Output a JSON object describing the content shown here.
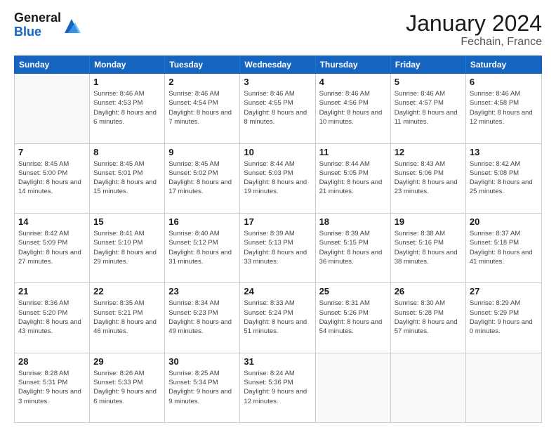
{
  "header": {
    "logo_general": "General",
    "logo_blue": "Blue",
    "title": "January 2024",
    "subtitle": "Fechain, France"
  },
  "days_of_week": [
    "Sunday",
    "Monday",
    "Tuesday",
    "Wednesday",
    "Thursday",
    "Friday",
    "Saturday"
  ],
  "weeks": [
    [
      {
        "day": "",
        "sunrise": "",
        "sunset": "",
        "daylight": ""
      },
      {
        "day": "1",
        "sunrise": "Sunrise: 8:46 AM",
        "sunset": "Sunset: 4:53 PM",
        "daylight": "Daylight: 8 hours and 6 minutes."
      },
      {
        "day": "2",
        "sunrise": "Sunrise: 8:46 AM",
        "sunset": "Sunset: 4:54 PM",
        "daylight": "Daylight: 8 hours and 7 minutes."
      },
      {
        "day": "3",
        "sunrise": "Sunrise: 8:46 AM",
        "sunset": "Sunset: 4:55 PM",
        "daylight": "Daylight: 8 hours and 8 minutes."
      },
      {
        "day": "4",
        "sunrise": "Sunrise: 8:46 AM",
        "sunset": "Sunset: 4:56 PM",
        "daylight": "Daylight: 8 hours and 10 minutes."
      },
      {
        "day": "5",
        "sunrise": "Sunrise: 8:46 AM",
        "sunset": "Sunset: 4:57 PM",
        "daylight": "Daylight: 8 hours and 11 minutes."
      },
      {
        "day": "6",
        "sunrise": "Sunrise: 8:46 AM",
        "sunset": "Sunset: 4:58 PM",
        "daylight": "Daylight: 8 hours and 12 minutes."
      }
    ],
    [
      {
        "day": "7",
        "sunrise": "Sunrise: 8:45 AM",
        "sunset": "Sunset: 5:00 PM",
        "daylight": "Daylight: 8 hours and 14 minutes."
      },
      {
        "day": "8",
        "sunrise": "Sunrise: 8:45 AM",
        "sunset": "Sunset: 5:01 PM",
        "daylight": "Daylight: 8 hours and 15 minutes."
      },
      {
        "day": "9",
        "sunrise": "Sunrise: 8:45 AM",
        "sunset": "Sunset: 5:02 PM",
        "daylight": "Daylight: 8 hours and 17 minutes."
      },
      {
        "day": "10",
        "sunrise": "Sunrise: 8:44 AM",
        "sunset": "Sunset: 5:03 PM",
        "daylight": "Daylight: 8 hours and 19 minutes."
      },
      {
        "day": "11",
        "sunrise": "Sunrise: 8:44 AM",
        "sunset": "Sunset: 5:05 PM",
        "daylight": "Daylight: 8 hours and 21 minutes."
      },
      {
        "day": "12",
        "sunrise": "Sunrise: 8:43 AM",
        "sunset": "Sunset: 5:06 PM",
        "daylight": "Daylight: 8 hours and 23 minutes."
      },
      {
        "day": "13",
        "sunrise": "Sunrise: 8:42 AM",
        "sunset": "Sunset: 5:08 PM",
        "daylight": "Daylight: 8 hours and 25 minutes."
      }
    ],
    [
      {
        "day": "14",
        "sunrise": "Sunrise: 8:42 AM",
        "sunset": "Sunset: 5:09 PM",
        "daylight": "Daylight: 8 hours and 27 minutes."
      },
      {
        "day": "15",
        "sunrise": "Sunrise: 8:41 AM",
        "sunset": "Sunset: 5:10 PM",
        "daylight": "Daylight: 8 hours and 29 minutes."
      },
      {
        "day": "16",
        "sunrise": "Sunrise: 8:40 AM",
        "sunset": "Sunset: 5:12 PM",
        "daylight": "Daylight: 8 hours and 31 minutes."
      },
      {
        "day": "17",
        "sunrise": "Sunrise: 8:39 AM",
        "sunset": "Sunset: 5:13 PM",
        "daylight": "Daylight: 8 hours and 33 minutes."
      },
      {
        "day": "18",
        "sunrise": "Sunrise: 8:39 AM",
        "sunset": "Sunset: 5:15 PM",
        "daylight": "Daylight: 8 hours and 36 minutes."
      },
      {
        "day": "19",
        "sunrise": "Sunrise: 8:38 AM",
        "sunset": "Sunset: 5:16 PM",
        "daylight": "Daylight: 8 hours and 38 minutes."
      },
      {
        "day": "20",
        "sunrise": "Sunrise: 8:37 AM",
        "sunset": "Sunset: 5:18 PM",
        "daylight": "Daylight: 8 hours and 41 minutes."
      }
    ],
    [
      {
        "day": "21",
        "sunrise": "Sunrise: 8:36 AM",
        "sunset": "Sunset: 5:20 PM",
        "daylight": "Daylight: 8 hours and 43 minutes."
      },
      {
        "day": "22",
        "sunrise": "Sunrise: 8:35 AM",
        "sunset": "Sunset: 5:21 PM",
        "daylight": "Daylight: 8 hours and 46 minutes."
      },
      {
        "day": "23",
        "sunrise": "Sunrise: 8:34 AM",
        "sunset": "Sunset: 5:23 PM",
        "daylight": "Daylight: 8 hours and 49 minutes."
      },
      {
        "day": "24",
        "sunrise": "Sunrise: 8:33 AM",
        "sunset": "Sunset: 5:24 PM",
        "daylight": "Daylight: 8 hours and 51 minutes."
      },
      {
        "day": "25",
        "sunrise": "Sunrise: 8:31 AM",
        "sunset": "Sunset: 5:26 PM",
        "daylight": "Daylight: 8 hours and 54 minutes."
      },
      {
        "day": "26",
        "sunrise": "Sunrise: 8:30 AM",
        "sunset": "Sunset: 5:28 PM",
        "daylight": "Daylight: 8 hours and 57 minutes."
      },
      {
        "day": "27",
        "sunrise": "Sunrise: 8:29 AM",
        "sunset": "Sunset: 5:29 PM",
        "daylight": "Daylight: 9 hours and 0 minutes."
      }
    ],
    [
      {
        "day": "28",
        "sunrise": "Sunrise: 8:28 AM",
        "sunset": "Sunset: 5:31 PM",
        "daylight": "Daylight: 9 hours and 3 minutes."
      },
      {
        "day": "29",
        "sunrise": "Sunrise: 8:26 AM",
        "sunset": "Sunset: 5:33 PM",
        "daylight": "Daylight: 9 hours and 6 minutes."
      },
      {
        "day": "30",
        "sunrise": "Sunrise: 8:25 AM",
        "sunset": "Sunset: 5:34 PM",
        "daylight": "Daylight: 9 hours and 9 minutes."
      },
      {
        "day": "31",
        "sunrise": "Sunrise: 8:24 AM",
        "sunset": "Sunset: 5:36 PM",
        "daylight": "Daylight: 9 hours and 12 minutes."
      },
      {
        "day": "",
        "sunrise": "",
        "sunset": "",
        "daylight": ""
      },
      {
        "day": "",
        "sunrise": "",
        "sunset": "",
        "daylight": ""
      },
      {
        "day": "",
        "sunrise": "",
        "sunset": "",
        "daylight": ""
      }
    ]
  ]
}
